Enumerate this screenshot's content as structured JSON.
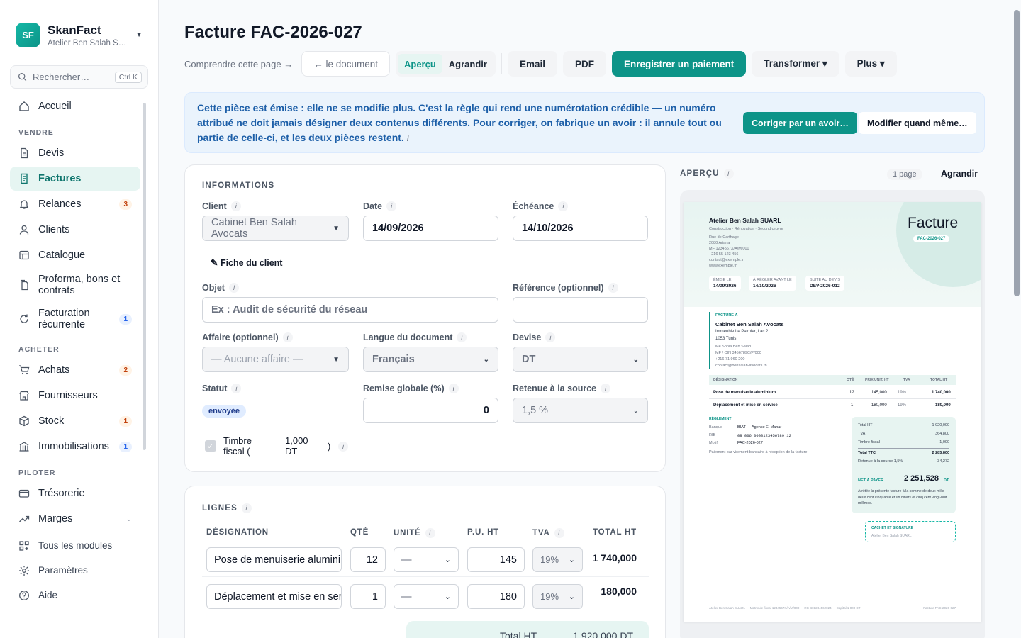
{
  "brand": {
    "logo": "SF",
    "name": "SkanFact",
    "company": "Atelier Ben Salah SU…"
  },
  "search": {
    "placeholder": "Rechercher…",
    "shortcut": "Ctrl K"
  },
  "nav": {
    "home": "Accueil",
    "sec_sell": "VENDRE",
    "quotes": "Devis",
    "invoices": "Factures",
    "reminders": "Relances",
    "reminders_badge": "3",
    "clients": "Clients",
    "catalog": "Catalogue",
    "proforma": "Proforma, bons et contrats",
    "recurring": "Facturation récurrente",
    "recurring_badge": "1",
    "sec_buy": "ACHETER",
    "purchases": "Achats",
    "purchases_badge": "2",
    "suppliers": "Fournisseurs",
    "stock": "Stock",
    "stock_badge": "1",
    "assets": "Immobilisations",
    "assets_badge": "1",
    "sec_steer": "PILOTER",
    "treasury": "Trésorerie",
    "margins": "Marges"
  },
  "bottom": {
    "modules": "Tous les modules",
    "settings": "Paramètres",
    "help": "Aide"
  },
  "page": {
    "title": "Facture FAC-2026-027"
  },
  "toolbar": {
    "help": "Comprendre cette page →",
    "back": "← le document",
    "preview": "Aperçu",
    "enlarge": "Agrandir",
    "email": "Email",
    "pdf": "PDF",
    "pay": "Enregistrer un paiement",
    "transform": "Transformer ▾",
    "more": "Plus ▾"
  },
  "banner": {
    "text": "Cette pièce est émise : elle ne se modifie plus. C'est la règle qui rend une numérotation crédible — un numéro attribué ne doit jamais désigner deux contenus différents. Pour corriger, on fabrique un avoir : il annule tout ou partie de celle-ci, et les deux pièces restent.",
    "fix": "Corriger par un avoir…",
    "force": "Modifier quand même…"
  },
  "info": {
    "title": "INFORMATIONS",
    "client_label": "Client",
    "client": "Cabinet Ben Salah Avocats",
    "date_label": "Date",
    "date": "14/09/2026",
    "due_label": "Échéance",
    "due": "14/10/2026",
    "client_sheet": "✎ Fiche du client",
    "object_label": "Objet",
    "object_placeholder": "Ex : Audit de sécurité du réseau",
    "ref_label": "Référence (optionnel)",
    "deal_label": "Affaire (optionnel)",
    "deal": "— Aucune affaire —",
    "lang_label": "Langue du document",
    "lang": "Français",
    "currency_label": "Devise",
    "currency": "DT",
    "status_label": "Statut",
    "status": "envoyée",
    "discount_label": "Remise globale (%)",
    "discount": "0",
    "withholding_label": "Retenue à la source",
    "withholding": "1,5 %",
    "stamp_label": "Timbre fiscal (",
    "stamp_value": "1,000 DT",
    "stamp_close": ")"
  },
  "lines": {
    "title": "LIGNES",
    "headers": [
      "DÉSIGNATION",
      "QTÉ",
      "UNITÉ",
      "P.U. HT",
      "TVA",
      "TOTAL HT"
    ],
    "rows": [
      {
        "designation": "Pose de menuiserie aluminium",
        "qty": "12",
        "unit": "—",
        "price": "145",
        "tva": "19%",
        "total": "1 740,000"
      },
      {
        "designation": "Déplacement et mise en service",
        "qty": "1",
        "unit": "—",
        "price": "180",
        "tva": "19%",
        "total": "180,000"
      }
    ],
    "total_label": "Total HT",
    "total_value": "1 920,000 DT"
  },
  "preview": {
    "title": "APERÇU",
    "pages": "1 page",
    "enlarge": "Agrandir",
    "company": "Atelier Ben Salah SUARL",
    "tagline": "Construction · Rénovation · Second œuvre",
    "addr": [
      "Rue de Carthage",
      "2080 Ariana",
      "MF 1234567X/A/M/000",
      "+216 55 123 456",
      "contact@exemple.tn",
      "www.exemple.tn"
    ],
    "doc_type": "Facture",
    "doc_no": "FAC-2026-027",
    "tags": [
      {
        "k": "ÉMISE LE",
        "v": "14/09/2026"
      },
      {
        "k": "À RÉGLER AVANT LE",
        "v": "14/10/2026"
      },
      {
        "k": "SUITE AU DEVIS",
        "v": "DEV-2026-012"
      }
    ],
    "bill_to": "FACTURÉ À",
    "bill_name": "Cabinet Ben Salah Avocats",
    "bill_addr": [
      "Immeuble Le Palmier, Lac 2",
      "1053 Tunis"
    ],
    "bill_more": [
      "Me Sonia Ben Salah",
      "MF / CIN 3456789C/P/000",
      "+216 71 960 200",
      "contact@bensalah-avocats.tn"
    ],
    "th": [
      "DÉSIGNATION",
      "QTÉ",
      "PRIX UNIT. HT",
      "TVA",
      "TOTAL HT"
    ],
    "rows": [
      [
        "Pose de menuiserie aluminium",
        "12",
        "145,000",
        "19%",
        "1 740,000"
      ],
      [
        "Déplacement et mise en service",
        "1",
        "180,000",
        "19%",
        "180,000"
      ]
    ],
    "payment": "RÈGLEMENT",
    "pay_rows": [
      [
        "Banque",
        "BIAT — Agence El Manar"
      ],
      [
        "RIB",
        "08 006 0000123456789 12"
      ],
      [
        "Motif",
        "FAC-2026-027"
      ]
    ],
    "pay_note": "Paiement par virement bancaire à réception de la facture.",
    "tot": [
      [
        "Total HT",
        "1 920,000"
      ],
      [
        "TVA",
        "364,800"
      ],
      [
        "Timbre fiscal",
        "1,000"
      ],
      [
        "Total TTC",
        "2 285,800"
      ],
      [
        "Retenue à la source 1,5%",
        "− 34,272"
      ]
    ],
    "net_label": "NET À PAYER",
    "net": "2 251,528",
    "net_cur": "DT",
    "words": "Arrêtée la présente facture à la somme de deux mille deux cent cinquante et un dinars et cinq cent vingt-huit millimes.",
    "stamp": "CACHET ET SIGNATURE",
    "stamp_sub": "Atelier Ben Salah SUARL",
    "footer": "Atelier Ben Salah SUARL — Matricule fiscal 1234567X/A/M/000 — RC B01234562024 — Capital 1 000 DT",
    "footer_right": "Facture FAC-2026-027"
  }
}
